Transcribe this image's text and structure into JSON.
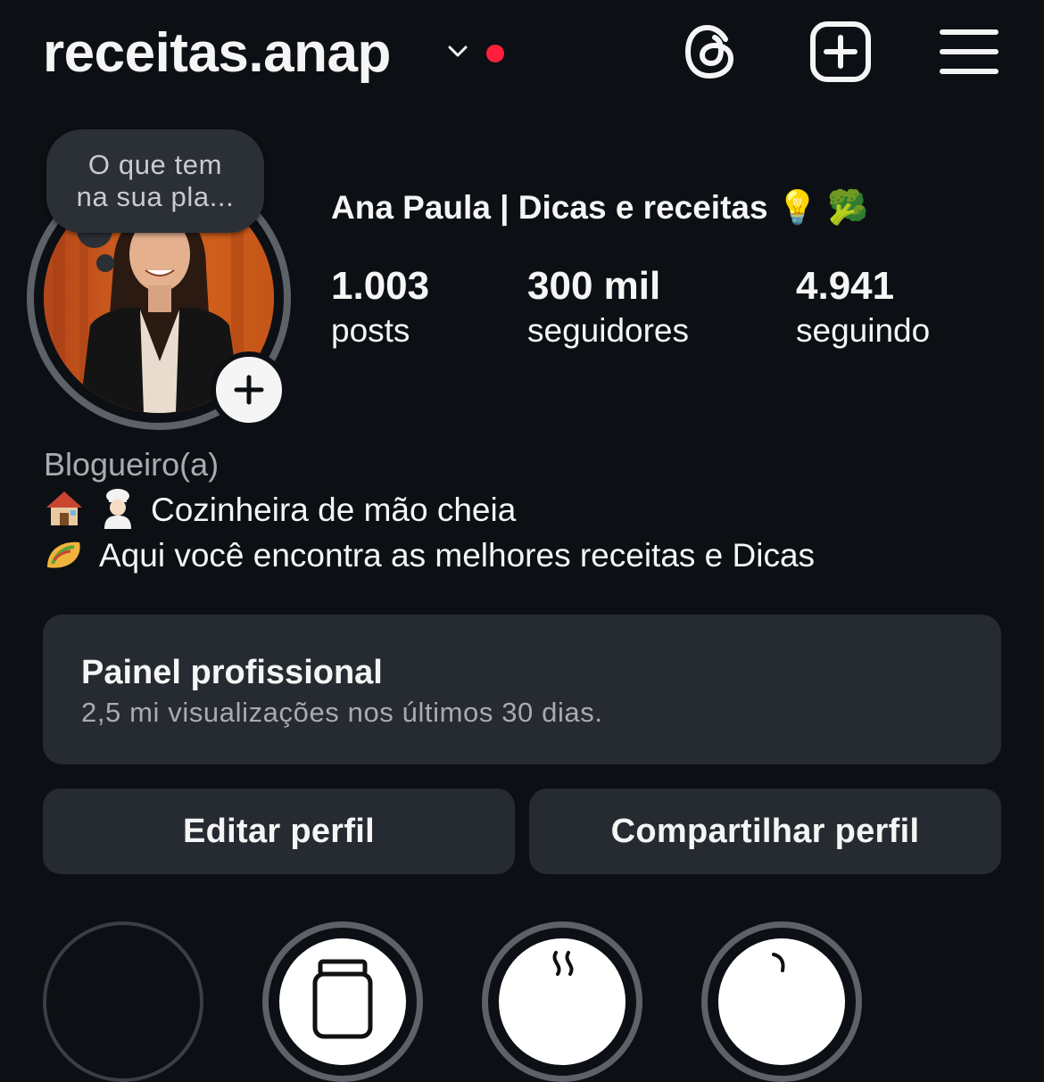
{
  "header": {
    "username": "receitas.anap",
    "icons": [
      "chevron-down-icon",
      "notification-dot",
      "threads-icon",
      "new-post-icon",
      "menu-icon"
    ],
    "accent_color": "#ff1e3c"
  },
  "note": {
    "text_line1": "O que tem",
    "text_line2": "na sua pla..."
  },
  "profile": {
    "display_name": "Ana Paula | Dicas e receitas 💡 🥦",
    "stats": {
      "posts_value": "1.003",
      "posts_label": "posts",
      "followers_value": "300 mil",
      "followers_label": "seguidores",
      "following_value": "4.941",
      "following_label": "seguindo"
    }
  },
  "bio": {
    "category": "Blogueiro(a)",
    "line1": "Cozinheira de mão cheia",
    "line2": "Aqui você encontra as melhores receitas e Dicas",
    "line1_icons": [
      "house-emoji-icon",
      "cook-emoji-icon"
    ],
    "line2_icons": [
      "taco-emoji-icon"
    ]
  },
  "dashboard": {
    "title": "Painel profissional",
    "subtitle": "2,5 mi visualizações nos últimos 30 dias."
  },
  "buttons": {
    "edit": "Editar perfil",
    "share": "Compartilhar perfil"
  },
  "colors": {
    "background": "#0c1014",
    "surface": "#262a31",
    "secondary_text": "#a8abb0"
  }
}
